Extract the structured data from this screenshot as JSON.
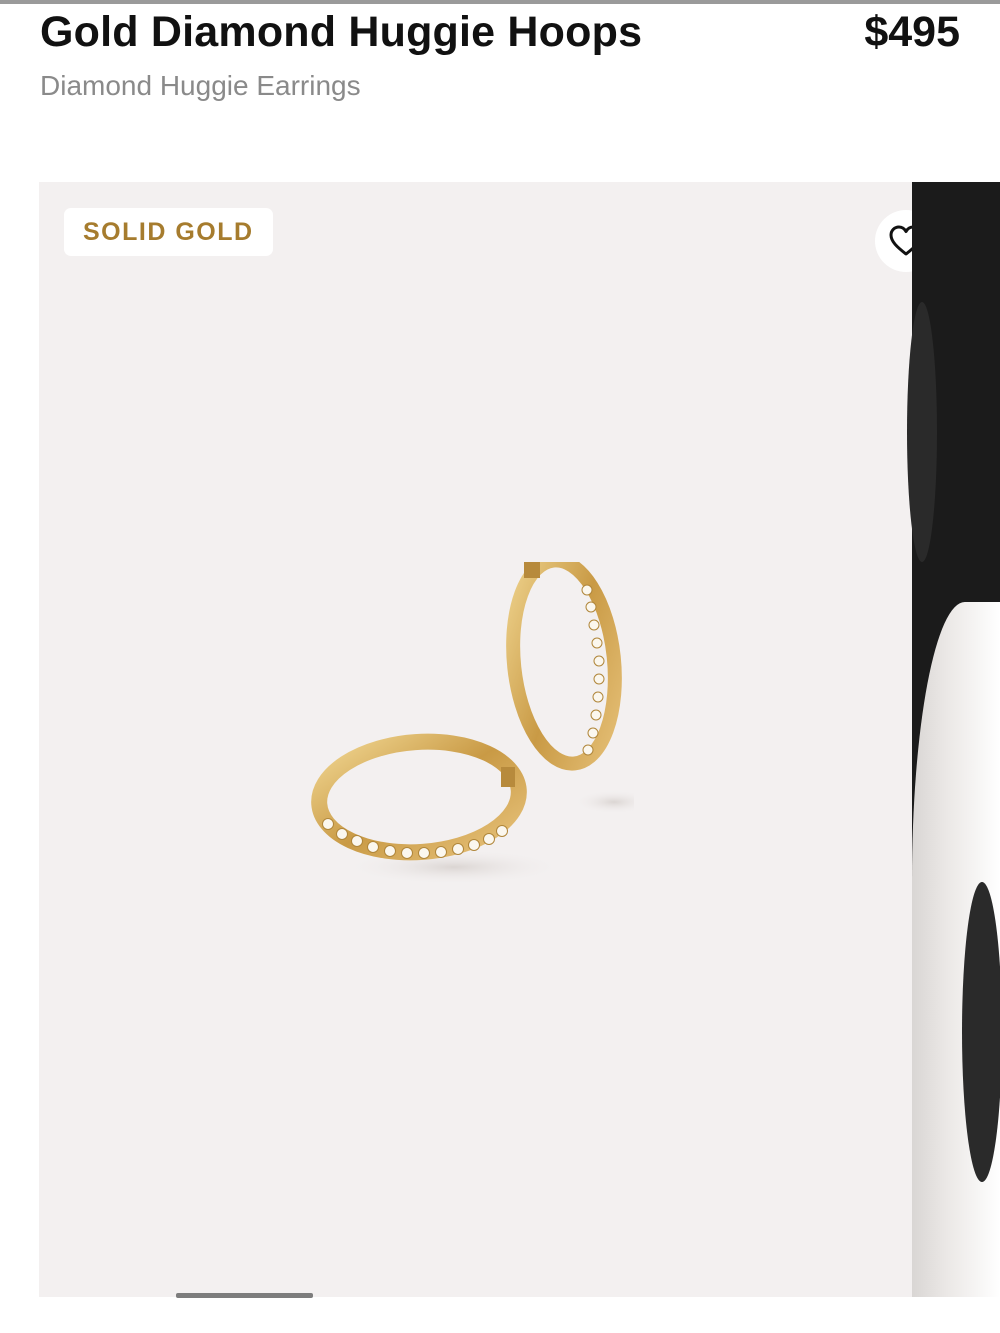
{
  "product": {
    "title": "Gold Diamond Huggie Hoops",
    "price": "$495",
    "subtitle": "Diamond Huggie Earrings"
  },
  "gallery": {
    "badge_label": "SOLID GOLD",
    "favorite_icon": "heart-outline-icon",
    "slides_count_visible": 2,
    "active_slide_index": 0
  },
  "colors": {
    "badge_text": "#a67c2e",
    "image_background": "#f3f0f0",
    "gold": "#d9b56a"
  }
}
